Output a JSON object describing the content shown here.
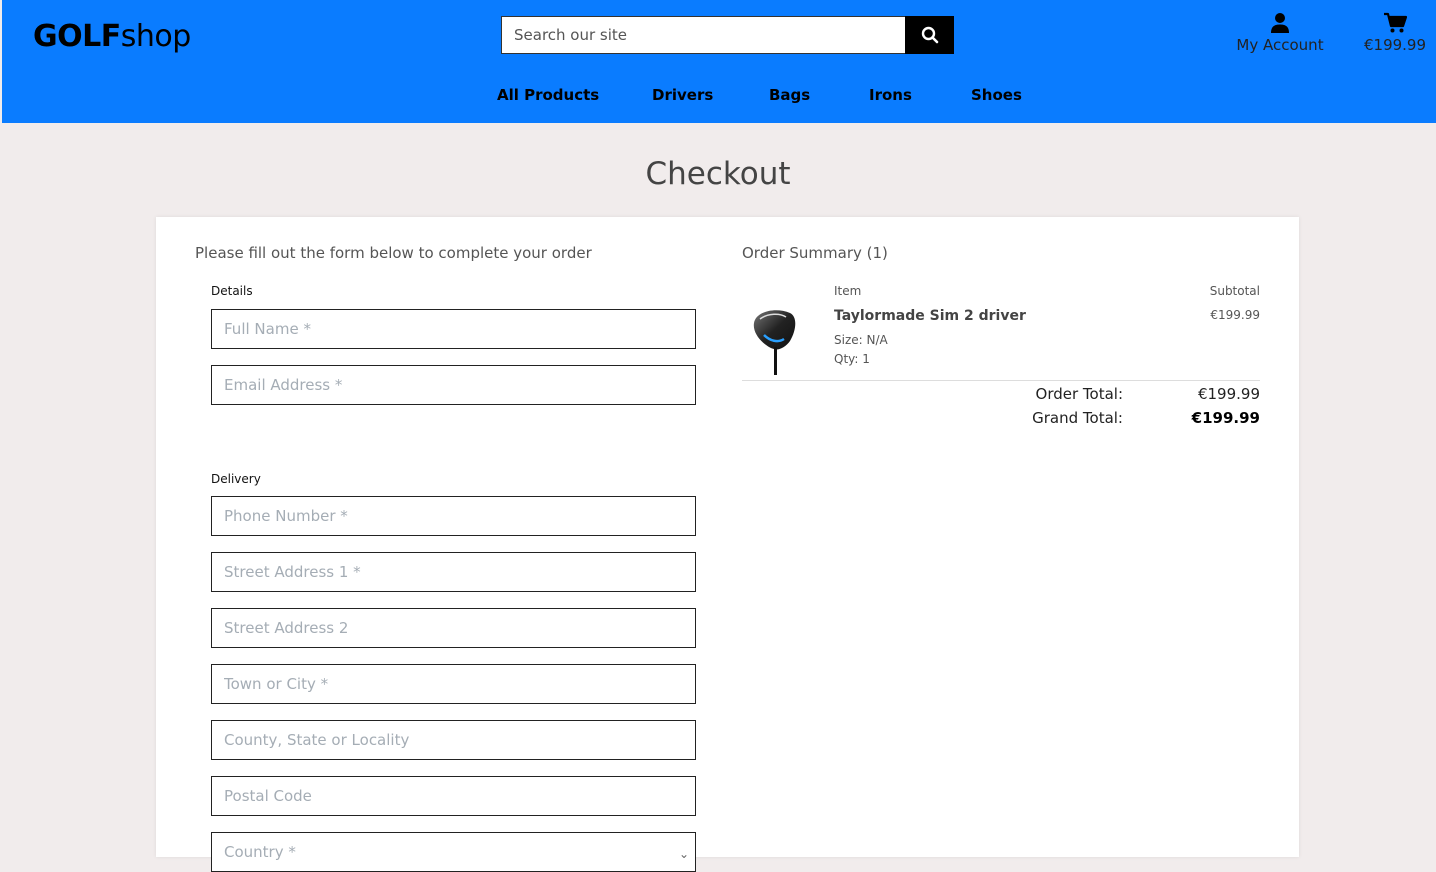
{
  "header": {
    "logo_bold": "GOLF",
    "logo_rest": "shop",
    "search_placeholder": "Search our site",
    "account_label": "My Account",
    "cart_total": "€199.99",
    "nav": [
      "All Products",
      "Drivers",
      "Bags",
      "Irons",
      "Shoes"
    ]
  },
  "page": {
    "title": "Checkout",
    "intro": "Please fill out the form below to complete your order"
  },
  "form": {
    "details_label": "Details",
    "full_name_placeholder": "Full Name *",
    "email_placeholder": "Email Address *",
    "delivery_label": "Delivery",
    "phone_placeholder": "Phone Number *",
    "street1_placeholder": "Street Address 1 *",
    "street2_placeholder": "Street Address 2",
    "town_placeholder": "Town or City *",
    "county_placeholder": "County, State or Locality",
    "postcode_placeholder": "Postal Code",
    "country_placeholder": "Country *"
  },
  "summary": {
    "title": "Order Summary (1)",
    "item_header": "Item",
    "subtotal_header": "Subtotal",
    "product": {
      "name": "Taylormade Sim 2 driver",
      "size": "Size: N/A",
      "qty": "Qty: 1",
      "price": "€199.99"
    },
    "order_total_label": "Order Total:",
    "order_total": "€199.99",
    "grand_total_label": "Grand Total:",
    "grand_total": "€199.99"
  }
}
